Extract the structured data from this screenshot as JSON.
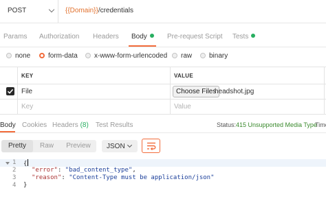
{
  "request": {
    "method": "POST",
    "url_variable": "{{Domain}}",
    "url_path": "/credentials"
  },
  "request_tabs": [
    {
      "label": "Params"
    },
    {
      "label": "Authorization"
    },
    {
      "label": "Headers"
    },
    {
      "label": "Body",
      "active": true,
      "dot": true
    },
    {
      "label": "Pre-request Script"
    },
    {
      "label": "Tests",
      "dot": true
    }
  ],
  "body_types": [
    {
      "label": "none"
    },
    {
      "label": "form-data",
      "selected": true
    },
    {
      "label": "x-www-form-urlencoded"
    },
    {
      "label": "raw"
    },
    {
      "label": "binary"
    }
  ],
  "form_table": {
    "headers": {
      "key": "KEY",
      "value": "VALUE"
    },
    "rows": [
      {
        "checked": true,
        "key": "File",
        "choose_label": "Choose Files",
        "filename": "headshot.jpg"
      }
    ],
    "placeholder": {
      "key": "Key",
      "value": "Value"
    }
  },
  "response_tabs": {
    "body": "Body",
    "cookies": "Cookies",
    "headers": "Headers",
    "headers_count": "(8)",
    "test_results": "Test Results"
  },
  "status": {
    "label": "Status:",
    "value": "415 Unsupported Media Type",
    "time_label": "Time"
  },
  "view_modes": [
    "Pretty",
    "Raw",
    "Preview"
  ],
  "format": "JSON",
  "response_body": {
    "line_numbers": [
      "1",
      "2",
      "3",
      "4"
    ],
    "open_brace": "{",
    "close_brace": "}",
    "error_key": "\"error\"",
    "error_value": "\"bad_content_type\"",
    "reason_key": "\"reason\"",
    "reason_value": "\"Content-Type must be application/json\""
  },
  "colors": {
    "accent": "#f26b3a",
    "status_success": "#27ae60",
    "url_variable": "#e1702c"
  },
  "icons": [
    "chevron-down-icon",
    "checkbox-check-icon",
    "wrap-lines-icon",
    "fold-arrow-icon"
  ]
}
